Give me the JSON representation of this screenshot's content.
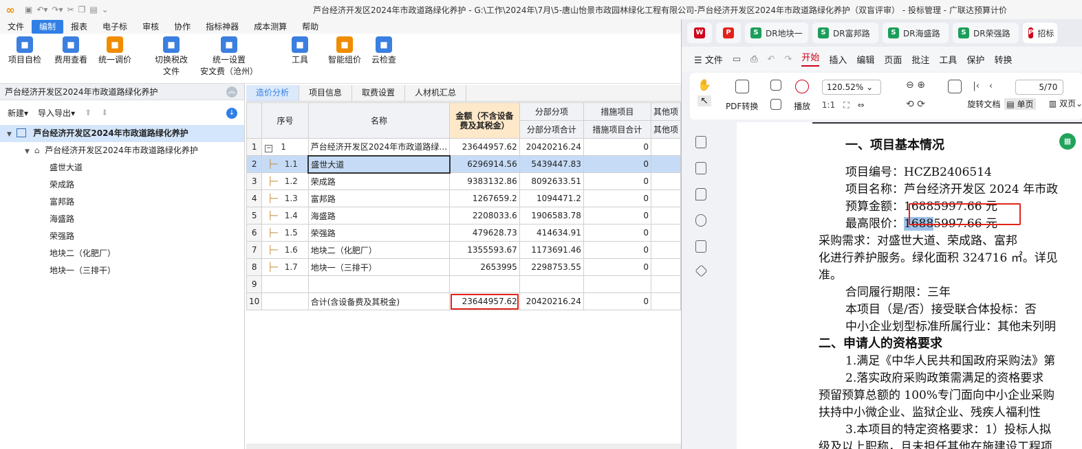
{
  "app": {
    "window_title": "芦台经济开发区2024年市政道路绿化养护 - G:\\工作\\2024年\\7月\\5-唐山怡景市政园林绿化工程有限公司-芦台经济开发区2024年市政道路绿化养护（双盲评审） - 投标管理 - 广联达预算计价"
  },
  "menu": [
    "文件",
    "编制",
    "报表",
    "电子标",
    "审核",
    "协作",
    "指标神器",
    "成本测算",
    "帮助"
  ],
  "menu_active": "编制",
  "ribbon": [
    {
      "label": "项目自检",
      "icon": "check-icon",
      "color": "#3b7fe0"
    },
    {
      "label": "费用查看",
      "icon": "cost-view-icon",
      "color": "#3b7fe0"
    },
    {
      "label": "统一调价",
      "icon": "price-adjust-icon",
      "color": "#f08c00"
    },
    {
      "label": "切换税改\n文件",
      "icon": "tax-switch-icon",
      "color": "#3b7fe0"
    },
    {
      "label": "统一设置\n安文费（沧州）",
      "icon": "settings-icon",
      "color": "#3b7fe0"
    },
    {
      "label": "工具",
      "icon": "tool-icon",
      "color": "#3b7fe0"
    },
    {
      "label": "智能组价",
      "icon": "smart-price-icon",
      "color": "#f08c00"
    },
    {
      "label": "云检查",
      "icon": "cloud-check-icon",
      "color": "#3b7fe0"
    }
  ],
  "left": {
    "header": "芦台经济开发区2024年市政道路绿化养护",
    "tools": [
      "新建",
      "导入导出"
    ],
    "tree_root": "芦台经济开发区2024年市政道路绿化养护",
    "tree_child": "芦台经济开发区2024年市政道路绿化养护",
    "items": [
      "盛世大道",
      "荣成路",
      "富邦路",
      "海盛路",
      "荣强路",
      "地块二（化肥厂）",
      "地块一（三排干）"
    ]
  },
  "tabs": [
    "造价分析",
    "项目信息",
    "取费设置",
    "人材机汇总"
  ],
  "tab_active": "造价分析",
  "table": {
    "headers": {
      "seq": "序号",
      "name": "名称",
      "amount": "金额（不含设备费及其税金）",
      "fbfx": "分部分项",
      "fbfx_total": "分部分项合计",
      "csxm": "措施项目",
      "csxm_total": "措施项目合计",
      "other": "其他项",
      "other_sub": "其他项"
    },
    "rows": [
      {
        "idx": "1",
        "seq": "1",
        "name": "芦台经济开发区2024年市政道路绿…",
        "amount": "23644957.62",
        "fbfx": "20420216.24",
        "cs": "0"
      },
      {
        "idx": "2",
        "seq": "1.1",
        "name": "盛世大道",
        "amount": "6296914.56",
        "fbfx": "5439447.83",
        "cs": "0"
      },
      {
        "idx": "3",
        "seq": "1.2",
        "name": "荣成路",
        "amount": "9383132.86",
        "fbfx": "8092633.51",
        "cs": "0"
      },
      {
        "idx": "4",
        "seq": "1.3",
        "name": "富邦路",
        "amount": "1267659.2",
        "fbfx": "1094471.2",
        "cs": "0"
      },
      {
        "idx": "5",
        "seq": "1.4",
        "name": "海盛路",
        "amount": "2208033.6",
        "fbfx": "1906583.78",
        "cs": "0"
      },
      {
        "idx": "6",
        "seq": "1.5",
        "name": "荣强路",
        "amount": "479628.73",
        "fbfx": "414634.91",
        "cs": "0"
      },
      {
        "idx": "7",
        "seq": "1.6",
        "name": "地块二（化肥厂）",
        "amount": "1355593.67",
        "fbfx": "1173691.46",
        "cs": "0"
      },
      {
        "idx": "8",
        "seq": "1.7",
        "name": "地块一（三排干）",
        "amount": "2653995",
        "fbfx": "2298753.55",
        "cs": "0"
      },
      {
        "idx": "9",
        "seq": "",
        "name": "",
        "amount": "",
        "fbfx": "",
        "cs": ""
      },
      {
        "idx": "10",
        "seq": "",
        "name": "合计(含设备费及其税金)",
        "amount": "23644957.62",
        "fbfx": "20420216.24",
        "cs": "0"
      }
    ]
  },
  "pdf": {
    "tabs": [
      "DR地块一",
      "DR富邦路",
      "DR海盛路",
      "DR荣强路",
      "招标"
    ],
    "menu": [
      "文件",
      "开始",
      "插入",
      "编辑",
      "页面",
      "批注",
      "工具",
      "保护",
      "转换"
    ],
    "menu_active": "开始",
    "tools": {
      "pdf_convert": "PDF转换",
      "play": "播放",
      "rotate": "旋转文档",
      "single": "单页",
      "double": "双页"
    },
    "zoom": "120.52%",
    "page": "5/70",
    "lines": [
      "一、项目基本情况",
      "项目编号：HCZB2406514",
      "项目名称：芦台经济开发区 2024 年市政",
      "预算金额：16885997.66 元",
      "最高限价：",
      "1688",
      "5997.66 元",
      "采购需求：对盛世大道、荣成路、富邦",
      "化进行养护服务。绿化面积 324716 ㎡。详见",
      "准。",
      "合同履行期限：三年",
      "本项目（是/否）接受联合体投标：否",
      "中小企业划型标准所属行业：其他未列明",
      "二、申请人的资格要求",
      "1.满足《中华人民共和国政府采购法》第",
      "2.落实政府采购政策需满足的资格要求",
      "预留预算总额的 100%专门面向中小企业采购",
      "扶持中小微企业、监狱企业、残疾人福利性",
      "3.本项目的特定资格要求：1）投标人拟",
      "级及以上职称，且未担任其他在施建设工程项"
    ]
  }
}
